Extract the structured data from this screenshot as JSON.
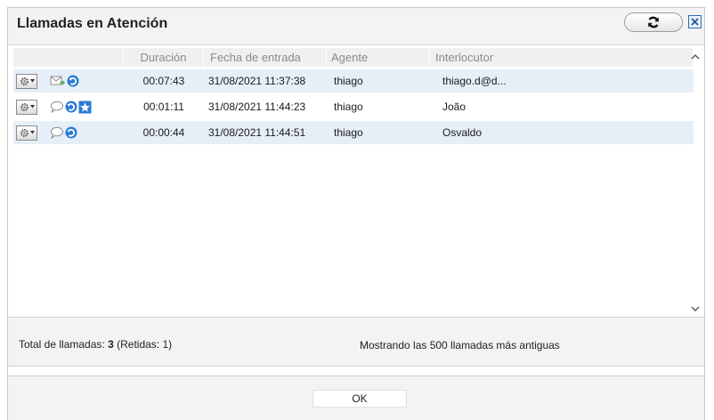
{
  "dialog": {
    "title": "Llamadas en Atención",
    "refresh_icon": "refresh-icon",
    "close_icon": "close-icon"
  },
  "table": {
    "columns": [
      "",
      "Duración",
      "Fecha de entrada",
      "Agente",
      "Interlocutor"
    ],
    "rows": [
      {
        "duration": "00:07:43",
        "date": "31/08/2021 11:37:38",
        "agent": "thiago",
        "interlocutor": "thiago.d@d...",
        "icons": [
          "gear-menu-icon",
          "email-icon",
          "transfer-icon"
        ]
      },
      {
        "duration": "00:01:11",
        "date": "31/08/2021 11:44:23",
        "agent": "thiago",
        "interlocutor": "João",
        "icons": [
          "gear-menu-icon",
          "chat-icon",
          "transfer-icon",
          "star-icon"
        ]
      },
      {
        "duration": "00:00:44",
        "date": "31/08/2021 11:44:51",
        "agent": "thiago",
        "interlocutor": "Osvaldo",
        "icons": [
          "gear-menu-icon",
          "chat-icon",
          "transfer-icon"
        ]
      }
    ]
  },
  "footer": {
    "total_label": "Total de llamadas:",
    "total_value": "3",
    "retained": "(Retidas: 1)",
    "showing": "Mostrando las 500 llamadas más antiguas"
  },
  "buttons": {
    "ok": "OK"
  },
  "colors": {
    "row_highlight": "#e6eff8",
    "accent_blue": "#2a7bd5"
  }
}
